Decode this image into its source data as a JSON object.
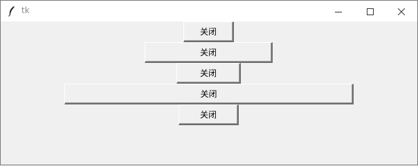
{
  "window": {
    "title": "tk",
    "icons": {
      "app": "feather-icon",
      "minimize": "minimize-icon",
      "maximize": "maximize-icon",
      "close": "close-icon"
    }
  },
  "buttons": [
    {
      "label": "关闭"
    },
    {
      "label": "关闭"
    },
    {
      "label": "关闭"
    },
    {
      "label": "关闭"
    },
    {
      "label": "关闭"
    }
  ]
}
